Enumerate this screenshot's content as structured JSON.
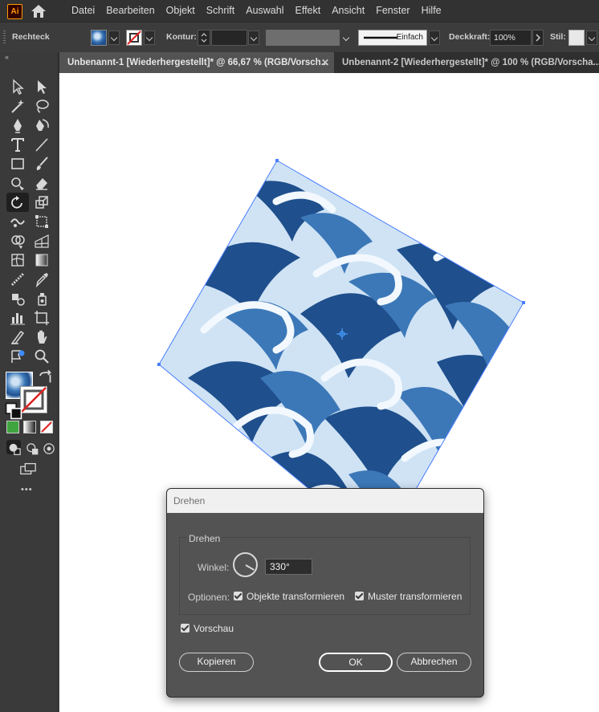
{
  "app": {
    "logo_text": "Ai"
  },
  "menu": [
    "Datei",
    "Bearbeiten",
    "Objekt",
    "Schrift",
    "Auswahl",
    "Effekt",
    "Ansicht",
    "Fenster",
    "Hilfe"
  ],
  "control_bar": {
    "object_type": "Rechteck",
    "stroke_label": "Kontur:",
    "stroke_style": "Einfach",
    "opacity_label": "Deckkraft:",
    "opacity_value": "100%",
    "style_label": "Stil:"
  },
  "tabs": [
    {
      "label": "Unbenannt-1 [Wiederhergestellt]* @ 66,67 % (RGB/Vorsch...",
      "active": true
    },
    {
      "label": "Unbenannt-2 [Wiederhergestellt]* @ 100 % (RGB/Vorscha...",
      "active": false
    }
  ],
  "tools": {
    "more_label": "•••"
  },
  "dialog": {
    "title": "Drehen",
    "group_label": "Drehen",
    "angle_label": "Winkel:",
    "angle_value": "330°",
    "options_label": "Optionen:",
    "transform_objects_label": "Objekte transformieren",
    "transform_objects_checked": true,
    "transform_patterns_label": "Muster transformieren",
    "transform_patterns_checked": true,
    "preview_label": "Vorschau",
    "preview_checked": true,
    "copy_button": "Kopieren",
    "ok_button": "OK",
    "cancel_button": "Abbrechen"
  },
  "colors": {
    "pattern_dark": "#1f4f8c",
    "pattern_mid": "#3c78b8",
    "pattern_light": "#cfe3f5",
    "selection": "#4a7dff"
  }
}
